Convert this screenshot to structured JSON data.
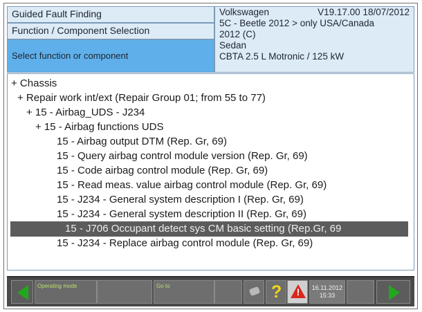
{
  "header": {
    "left_row1": "Guided Fault Finding",
    "left_row2": "Function / Component Selection",
    "left_row3": "Select function or component",
    "brand": "Volkswagen",
    "version": "V19.17.00 18/07/2012",
    "vehicle_line2": "5C - Beetle 2012 > only USA/Canada",
    "vehicle_line3": "2012 (C)",
    "vehicle_line4": "Sedan",
    "vehicle_line5": "CBTA 2.5 L Motronic / 125 kW"
  },
  "tree": {
    "items": [
      "+  Chassis",
      "+  Repair work int/ext (Repair Group 01; from 55 to 77)",
      "+  15 - Airbag_UDS - J234",
      "+  15 - Airbag functions UDS",
      "15 - Airbag output DTM (Rep. Gr, 69)",
      "15 - Query airbag control module version (Rep. Gr, 69)",
      "15 - Code airbag control module (Rep. Gr, 69)",
      "15 - Read meas. value airbag control module (Rep. Gr, 69)",
      "15 - J234 - General system description I (Rep. Gr, 69)",
      "15 - J234 - General system description II (Rep. Gr, 69)",
      "15 - J706 Occupant detect sys CM basic setting (Rep.Gr, 69",
      "15 - J234 - Replace airbag control module (Rep. Gr, 69)"
    ]
  },
  "toolbar": {
    "operating_mode": "Operating mode",
    "goto": "Go to",
    "help_symbol": "?",
    "warn_symbol": "!",
    "date": "16.11.2012",
    "time": "15:33"
  },
  "colors": {
    "header_bg": "#ddebf6",
    "header_selected": "#5fb0ea",
    "selection_bg": "#5c5c5c",
    "nav_arrow": "#22a81c"
  },
  "icons": [
    "arrow-left-icon",
    "wrench-icon",
    "help-icon",
    "warning-icon",
    "arrow-right-icon"
  ]
}
